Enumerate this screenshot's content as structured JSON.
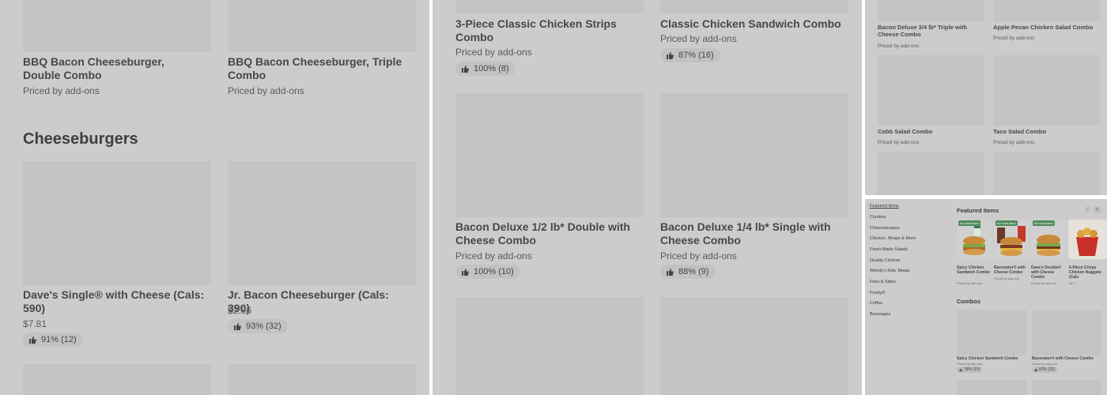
{
  "panel1": {
    "items_top": [
      {
        "name": "BBQ Bacon Cheeseburger, Double Combo",
        "sub": "Priced by add-ons"
      },
      {
        "name": "BBQ Bacon Cheeseburger, Triple Combo",
        "sub": "Priced by add-ons"
      }
    ],
    "section_title": "Cheeseburgers",
    "items": [
      {
        "name": "Dave's Single® with Cheese (Cals: 590)",
        "price": "$7.81",
        "rating": "91% (12)"
      },
      {
        "name": "Jr. Bacon Cheeseburger (Cals: 390)",
        "price": "$2.86",
        "rating": "93% (32)"
      }
    ]
  },
  "panel2": {
    "items": [
      {
        "name": "3-Piece Classic Chicken Strips Combo",
        "sub": "Priced by add-ons",
        "rating": "100% (8)"
      },
      {
        "name": "Classic Chicken Sandwich Combo",
        "sub": "Priced by add-ons",
        "rating": "87% (16)"
      },
      {
        "name": "Bacon Deluxe 1/2 lb* Double with Cheese Combo",
        "sub": "Priced by add-ons",
        "rating": "100% (10)"
      },
      {
        "name": "Bacon Deluxe 1/4 lb* Single with Cheese Combo",
        "sub": "Priced by add-ons",
        "rating": "88% (9)"
      }
    ]
  },
  "panel3": {
    "items": [
      {
        "name": "Bacon Deluxe 3/4 lb* Triple with Cheese Combo",
        "sub": "Priced by add-ons"
      },
      {
        "name": "Apple Pecan Chicken Salad Combo",
        "sub": "Priced by add-ons"
      },
      {
        "name": "Cobb Salad Combo",
        "sub": "Priced by add-ons"
      },
      {
        "name": "Taco Salad Combo",
        "sub": "Priced by add-ons"
      }
    ]
  },
  "panel4": {
    "nav": [
      "Featured items",
      "Combos",
      "Cheeseburgers",
      "Chicken, Wraps & More",
      "Fresh-Made Salads",
      "Quality Choices",
      "Wendy's Kids' Meals",
      "Fries & Sides",
      "Frosty®",
      "Coffee",
      "Beverages"
    ],
    "featured_title": "Featured Items",
    "featured": [
      {
        "tag": "#1 most liked",
        "name": "Spicy Chicken Sandwich Combo",
        "sub": "Priced by add-ons"
      },
      {
        "tag": "#2 most liked",
        "name": "Baconator® with Cheese Combo",
        "sub": "Priced by add-ons"
      },
      {
        "tag": "#3 most liked",
        "name": "Dave's Double® with Cheese Combo",
        "sub": "Priced by add-ons"
      },
      {
        "tag": "",
        "name": "6-Piece Crispy Chicken Nuggets (Cals",
        "sub": "$4.0"
      }
    ],
    "combos_title": "Combos",
    "combos": [
      {
        "name": "Spicy Chicken Sandwich Combo",
        "sub": "Priced by add-ons",
        "rating": "78% (37)"
      },
      {
        "name": "Baconator® with Cheese Combo",
        "sub": "Priced by add-ons",
        "rating": "87% (32)"
      }
    ]
  },
  "icons": {
    "thumb": "thumbs-up-icon",
    "prev": "chevron-left-icon",
    "next": "chevron-right-icon"
  },
  "colors": {
    "overlay": "#cccccc",
    "placeholder": "#c4c4c4",
    "tag_green": "#4d8a5a"
  }
}
